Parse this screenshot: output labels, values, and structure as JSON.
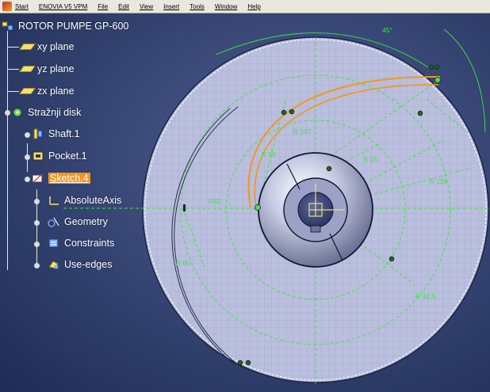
{
  "menubar": {
    "items": [
      "Start",
      "ENOVIA V5 VPM",
      "File",
      "Edit",
      "View",
      "Insert",
      "Tools",
      "Window",
      "Help"
    ]
  },
  "tree": {
    "root": "ROTOR PUMPE GP-600",
    "planes": [
      "xy plane",
      "yz plane",
      "zx plane"
    ],
    "body": "Stražnji disk",
    "features": [
      "Shaft.1",
      "Pocket.1"
    ],
    "sketch": "Sketch.4",
    "sketch_children": [
      "AbsoluteAxis",
      "Geometry",
      "Constraints",
      "Use-edges"
    ]
  },
  "icons": {
    "root": "product-icon",
    "plane": "plane-icon",
    "body": "body-icon",
    "shaft": "shaft-icon",
    "pocket": "pocket-icon",
    "sketch": "sketch-icon",
    "axis": "axis-icon",
    "geometry": "geometry-icon",
    "constraints": "constraints-icon",
    "use_edges": "use-edges-icon"
  },
  "dimensions": {
    "angle": "45°",
    "r137": "R 137",
    "r56": "R 56",
    "r15": "R 15",
    "r118": "R 118",
    "r42": "R42",
    "r80": "R 80",
    "r425": "R 42.5"
  },
  "colors": {
    "background": "#2e3e6e",
    "disk": "#b9bfdc",
    "sketch_green": "#3fe43f",
    "highlight_orange": "#f7941d",
    "menubar": "#e9e7de"
  }
}
